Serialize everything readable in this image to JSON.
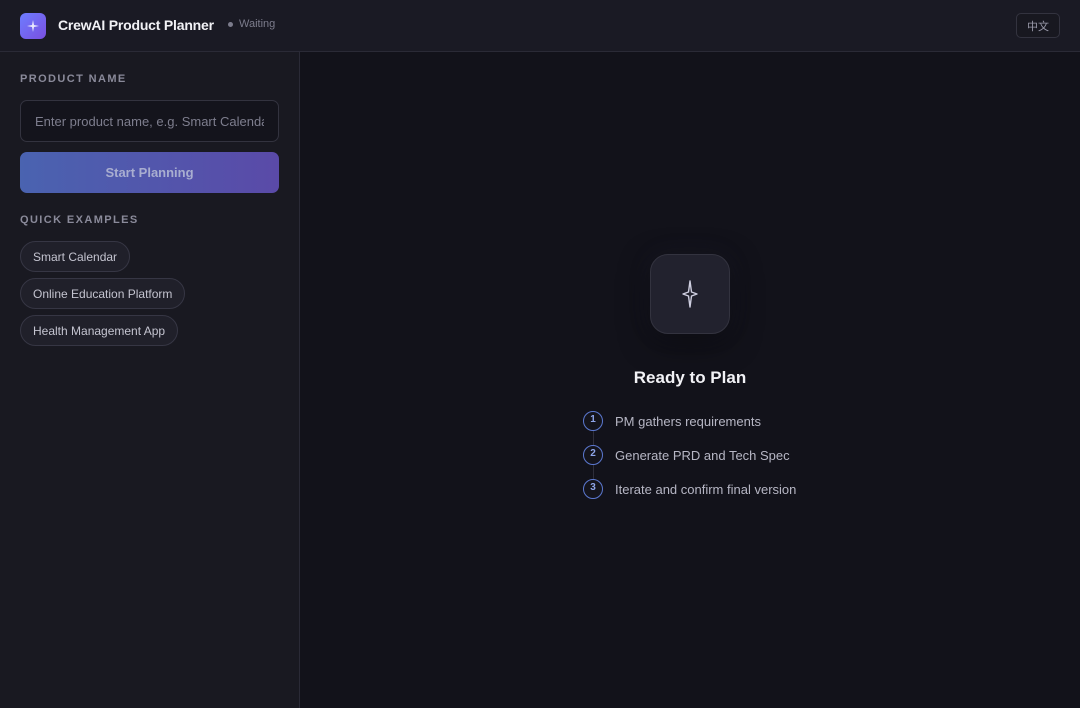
{
  "header": {
    "title": "CrewAI Product Planner",
    "status": "Waiting",
    "lang_button": "中文",
    "logo_icon": "sparkle-icon"
  },
  "sidebar": {
    "product_label": "PRODUCT NAME",
    "input_placeholder": "Enter product name, e.g. Smart Calendar",
    "input_value": "",
    "start_button": "Start Planning",
    "examples_label": "QUICK EXAMPLES",
    "examples": [
      "Smart Calendar",
      "Online Education Platform",
      "Health Management App"
    ]
  },
  "main": {
    "hero_icon": "sparkle-icon",
    "title": "Ready to Plan",
    "steps": [
      {
        "num": "1",
        "text": "PM gathers requirements"
      },
      {
        "num": "2",
        "text": "Generate PRD and Tech Spec"
      },
      {
        "num": "3",
        "text": "Iterate and confirm final version"
      }
    ]
  },
  "colors": {
    "accent": "#5b78d0",
    "brand_gradient_start": "#6d7dff",
    "brand_gradient_end": "#7a4fe0",
    "background": "#12121a"
  }
}
